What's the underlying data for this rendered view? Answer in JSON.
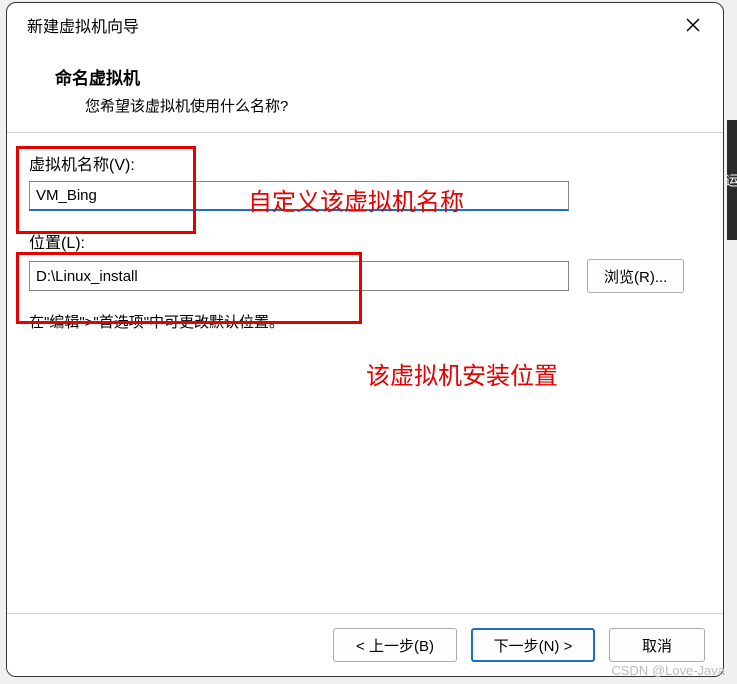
{
  "dialog": {
    "title": "新建虚拟机向导",
    "header_title": "命名虚拟机",
    "header_subtitle": "您希望该虚拟机使用什么名称?"
  },
  "fields": {
    "name_label": "虚拟机名称(V):",
    "name_value": "VM_Bing",
    "location_label": "位置(L):",
    "location_value": "D:\\Linux_install",
    "browse_label": "浏览(R)...",
    "hint": "在\"编辑\">\"首选项\"中可更改默认位置。"
  },
  "annotations": {
    "text1": "自定义该虚拟机名称",
    "text2": "该虚拟机安装位置"
  },
  "buttons": {
    "back": "< 上一步(B)",
    "next": "下一步(N) >",
    "cancel": "取消"
  },
  "side_strip": "运",
  "watermark": "CSDN @Love-Java"
}
